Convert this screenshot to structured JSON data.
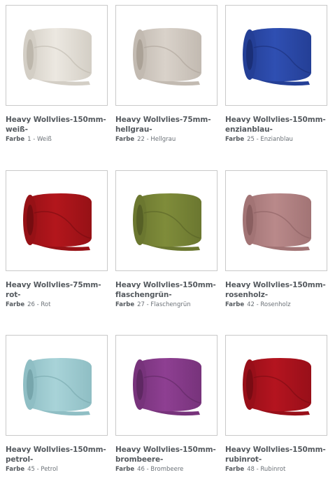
{
  "meta_label": "Farbe",
  "products": [
    {
      "title": "Heavy Wollvlies-150mm-weiß-",
      "value": "1 - Weiß",
      "color": "#ece8e1",
      "shade": "#d3cec5",
      "dark": "#bdb7ac"
    },
    {
      "title": "Heavy Wollvlies-75mm-hellgrau-",
      "value": "22 - Hellgrau",
      "color": "#d9d2ca",
      "shade": "#c2bab1",
      "dark": "#aba297"
    },
    {
      "title": "Heavy Wollvlies-150mm-enzianblau-",
      "value": "25 - Enzianblau",
      "color": "#2f4fb2",
      "shade": "#243f96",
      "dark": "#1a2f78"
    },
    {
      "title": "Heavy Wollvlies-75mm-rot-",
      "value": "26 - Rot",
      "color": "#b3161c",
      "shade": "#961116",
      "dark": "#760c10"
    },
    {
      "title": "Heavy Wollvlies-150mm-flaschengrün-",
      "value": "27 - Flaschengrün",
      "color": "#7f8c3a",
      "shade": "#6b7730",
      "dark": "#566026"
    },
    {
      "title": "Heavy Wollvlies-150mm-rosenholz-",
      "value": "42 - Rosenholz",
      "color": "#b9898a",
      "shade": "#a27475",
      "dark": "#8a5f60"
    },
    {
      "title": "Heavy Wollvlies-150mm-petrol-",
      "value": "45 - Petrol",
      "color": "#a8d3d8",
      "shade": "#8fbec4",
      "dark": "#77a6ac"
    },
    {
      "title": "Heavy Wollvlies-150mm-brombeere-",
      "value": "46 - Brombeere",
      "color": "#8e3f92",
      "shade": "#77337b",
      "dark": "#5f2863"
    },
    {
      "title": "Heavy Wollvlies-150mm-rubinrot-",
      "value": "48 - Rubinrot",
      "color": "#b4141f",
      "shade": "#980f19",
      "dark": "#7a0b13"
    }
  ]
}
